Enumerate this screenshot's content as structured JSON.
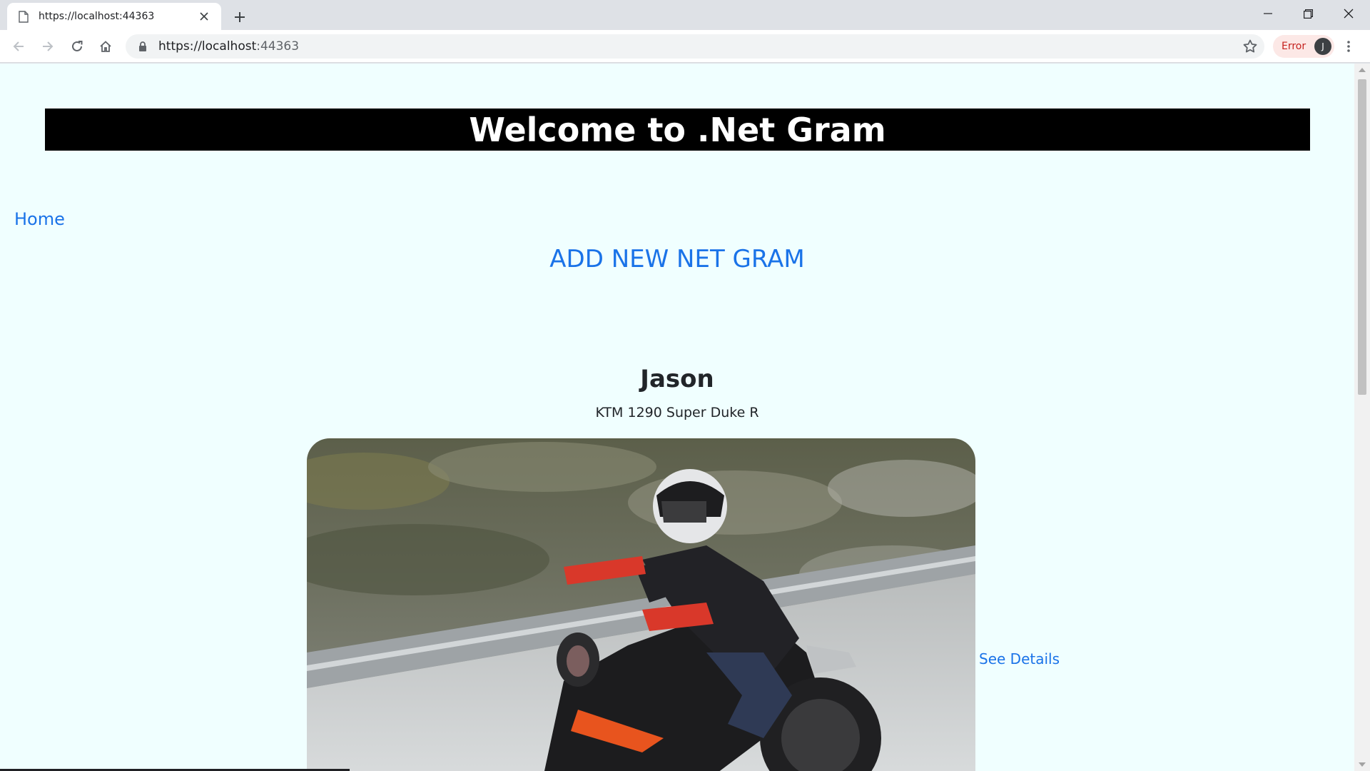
{
  "browser": {
    "tab": {
      "title": "https://localhost:44363",
      "icon": "page-icon"
    },
    "omnibox": {
      "url_host": "https://localhost",
      "url_port": ":44363"
    },
    "profile": {
      "status": "Error",
      "initial": "J"
    }
  },
  "page": {
    "banner_title": "Welcome to .Net Gram",
    "nav": {
      "home_label": "Home"
    },
    "add_link_label": "ADD NEW NET GRAM",
    "post": {
      "author": "Jason",
      "caption": "KTM 1290 Super Duke R",
      "image": "motorcycle-rider-photo",
      "details_link": "See Details"
    }
  },
  "colors": {
    "page_background": "#f0ffff",
    "banner_background": "#000000",
    "link": "#1a73e8",
    "error_chip": "#fce8e6"
  }
}
